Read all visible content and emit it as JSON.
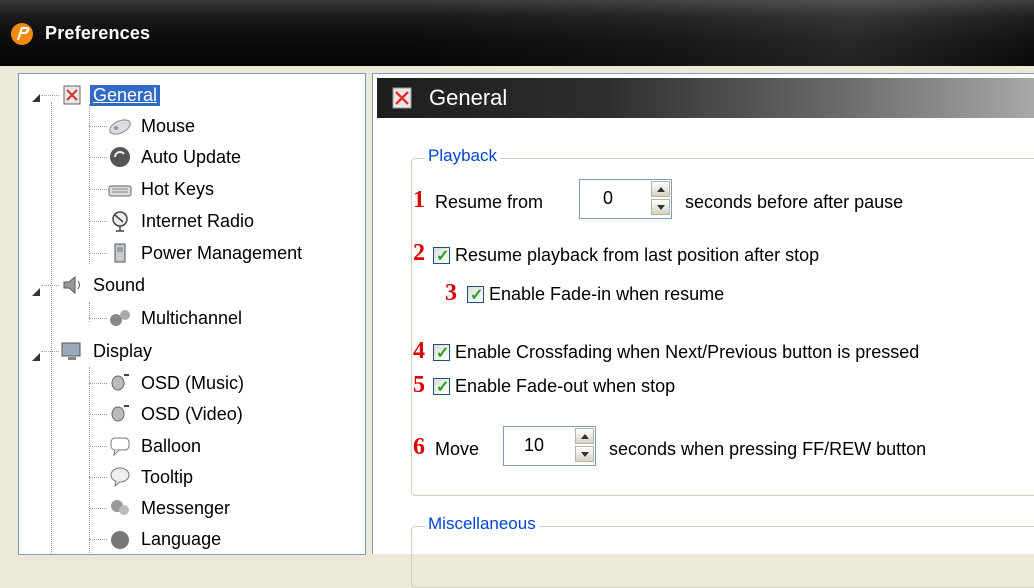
{
  "window": {
    "title": "Preferences"
  },
  "tree": {
    "items": [
      {
        "label": "General",
        "icon": "general-icon",
        "selected": true
      },
      {
        "label": "Mouse",
        "icon": "mouse-icon"
      },
      {
        "label": "Auto Update",
        "icon": "auto-update-icon"
      },
      {
        "label": "Hot Keys",
        "icon": "keyboard-icon"
      },
      {
        "label": "Internet Radio",
        "icon": "radio-icon"
      },
      {
        "label": "Power Management",
        "icon": "power-icon"
      },
      {
        "label": "Sound",
        "icon": "speaker-icon"
      },
      {
        "label": "Multichannel",
        "icon": "multichannel-icon"
      },
      {
        "label": "Display",
        "icon": "monitor-icon"
      },
      {
        "label": "OSD (Music)",
        "icon": "osd-icon"
      },
      {
        "label": "OSD (Video)",
        "icon": "osd-icon"
      },
      {
        "label": "Balloon",
        "icon": "balloon-icon"
      },
      {
        "label": "Tooltip",
        "icon": "tooltip-icon"
      },
      {
        "label": "Messenger",
        "icon": "messenger-icon"
      },
      {
        "label": "Language",
        "icon": "language-icon"
      }
    ]
  },
  "panel": {
    "title": "General",
    "playback": {
      "group_label": "Playback",
      "resume_from": {
        "num": "1",
        "label": "Resume from",
        "value": "0",
        "suffix": "seconds before after pause"
      },
      "resume_last": {
        "num": "2",
        "label": "Resume playback from last position after stop",
        "checked": true
      },
      "fade_in": {
        "num": "3",
        "label": "Enable Fade-in when resume",
        "checked": true
      },
      "crossfade": {
        "num": "4",
        "label": "Enable Crossfading when Next/Previous button is pressed",
        "checked": true
      },
      "fade_out": {
        "num": "5",
        "label": "Enable Fade-out when stop",
        "checked": true
      },
      "move": {
        "num": "6",
        "label": "Move",
        "value": "10",
        "suffix": "seconds when pressing FF/REW button"
      }
    },
    "misc": {
      "group_label": "Miscellaneous"
    }
  },
  "colors": {
    "accent_number": "#dd0000",
    "selection": "#316ac5",
    "group_label": "#0046d5"
  }
}
